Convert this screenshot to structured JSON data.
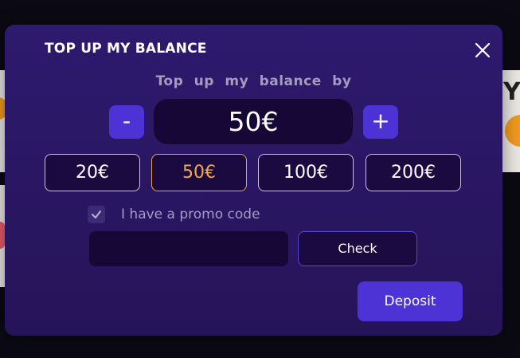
{
  "modal": {
    "title": "TOP UP MY BALANCE",
    "subtitle": "Top up my balance by",
    "amount": "50€",
    "minus_label": "-",
    "plus_label": "+",
    "presets": [
      {
        "label": "20€",
        "selected": false
      },
      {
        "label": "50€",
        "selected": true
      },
      {
        "label": "100€",
        "selected": false
      },
      {
        "label": "200€",
        "selected": false
      }
    ],
    "promo": {
      "checked": true,
      "label": "I have a promo code",
      "input_value": "",
      "check_label": "Check"
    },
    "deposit_label": "Deposit",
    "close_icon": "close-icon"
  },
  "colors": {
    "modal_bg": "#2a1764",
    "accent": "#4d32d6",
    "selected_preset": "#f0a84a",
    "muted_text": "#a39cc0"
  }
}
